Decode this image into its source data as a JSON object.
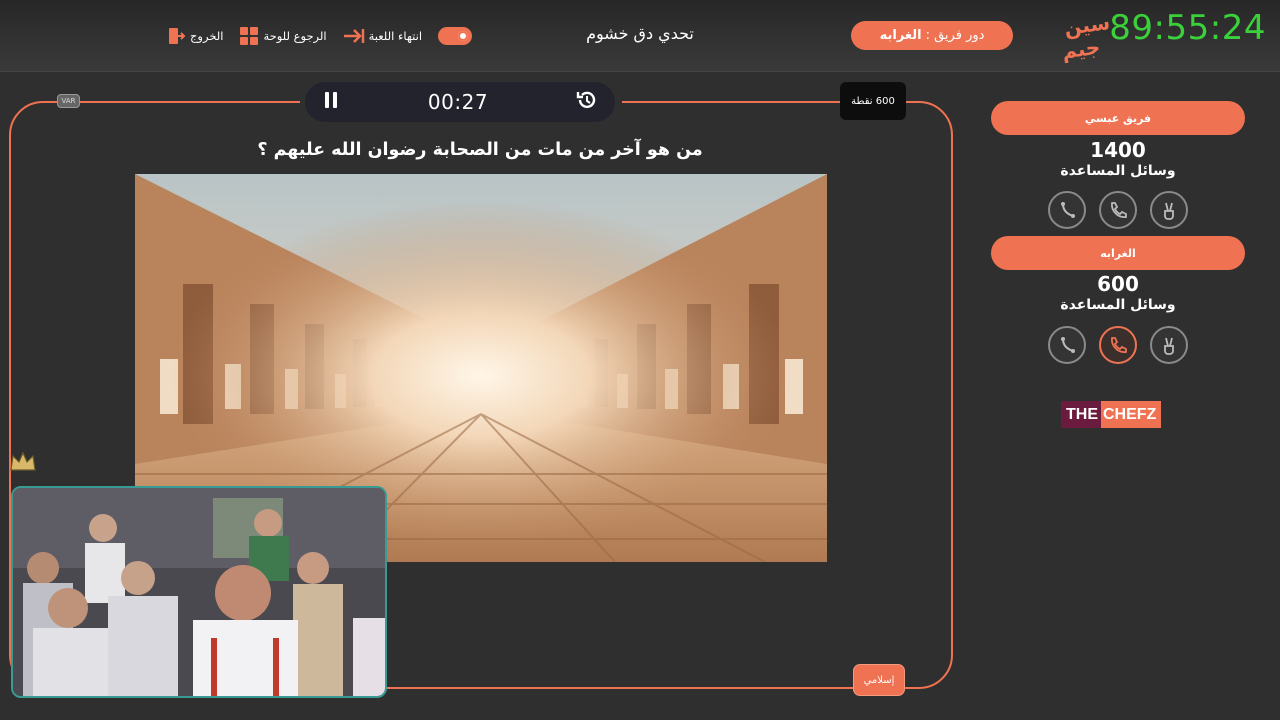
{
  "header": {
    "clock": "89:55:24",
    "logo_text": "سين جيم",
    "turn_label": "دور فريق :",
    "turn_team": "الغرابه",
    "game_title": "تحدي دق خشوم",
    "controls": {
      "end_game": "انتهاء اللعبة",
      "back_to_board": "الرجوع للوحة",
      "exit": "الخروج"
    }
  },
  "board": {
    "timer": "00:27",
    "var_label": "VAR",
    "points": "600 نقطة",
    "question": "من هو آخر من مات من الصحابة رضوان الله عليهم ؟",
    "category": "إسلامي"
  },
  "teams": [
    {
      "name": "فريق عبسي",
      "score": "1400",
      "aids_label": "وسائل المساعدة",
      "call_used": false
    },
    {
      "name": "الغرابه",
      "score": "600",
      "aids_label": "وسائل المساعدة",
      "call_used": true
    }
  ],
  "sponsor": {
    "part1": "THE",
    "part2": "CHEFZ"
  },
  "colors": {
    "accent": "#ef7352",
    "clock": "#3ad13a",
    "background": "#2f2f2f"
  }
}
